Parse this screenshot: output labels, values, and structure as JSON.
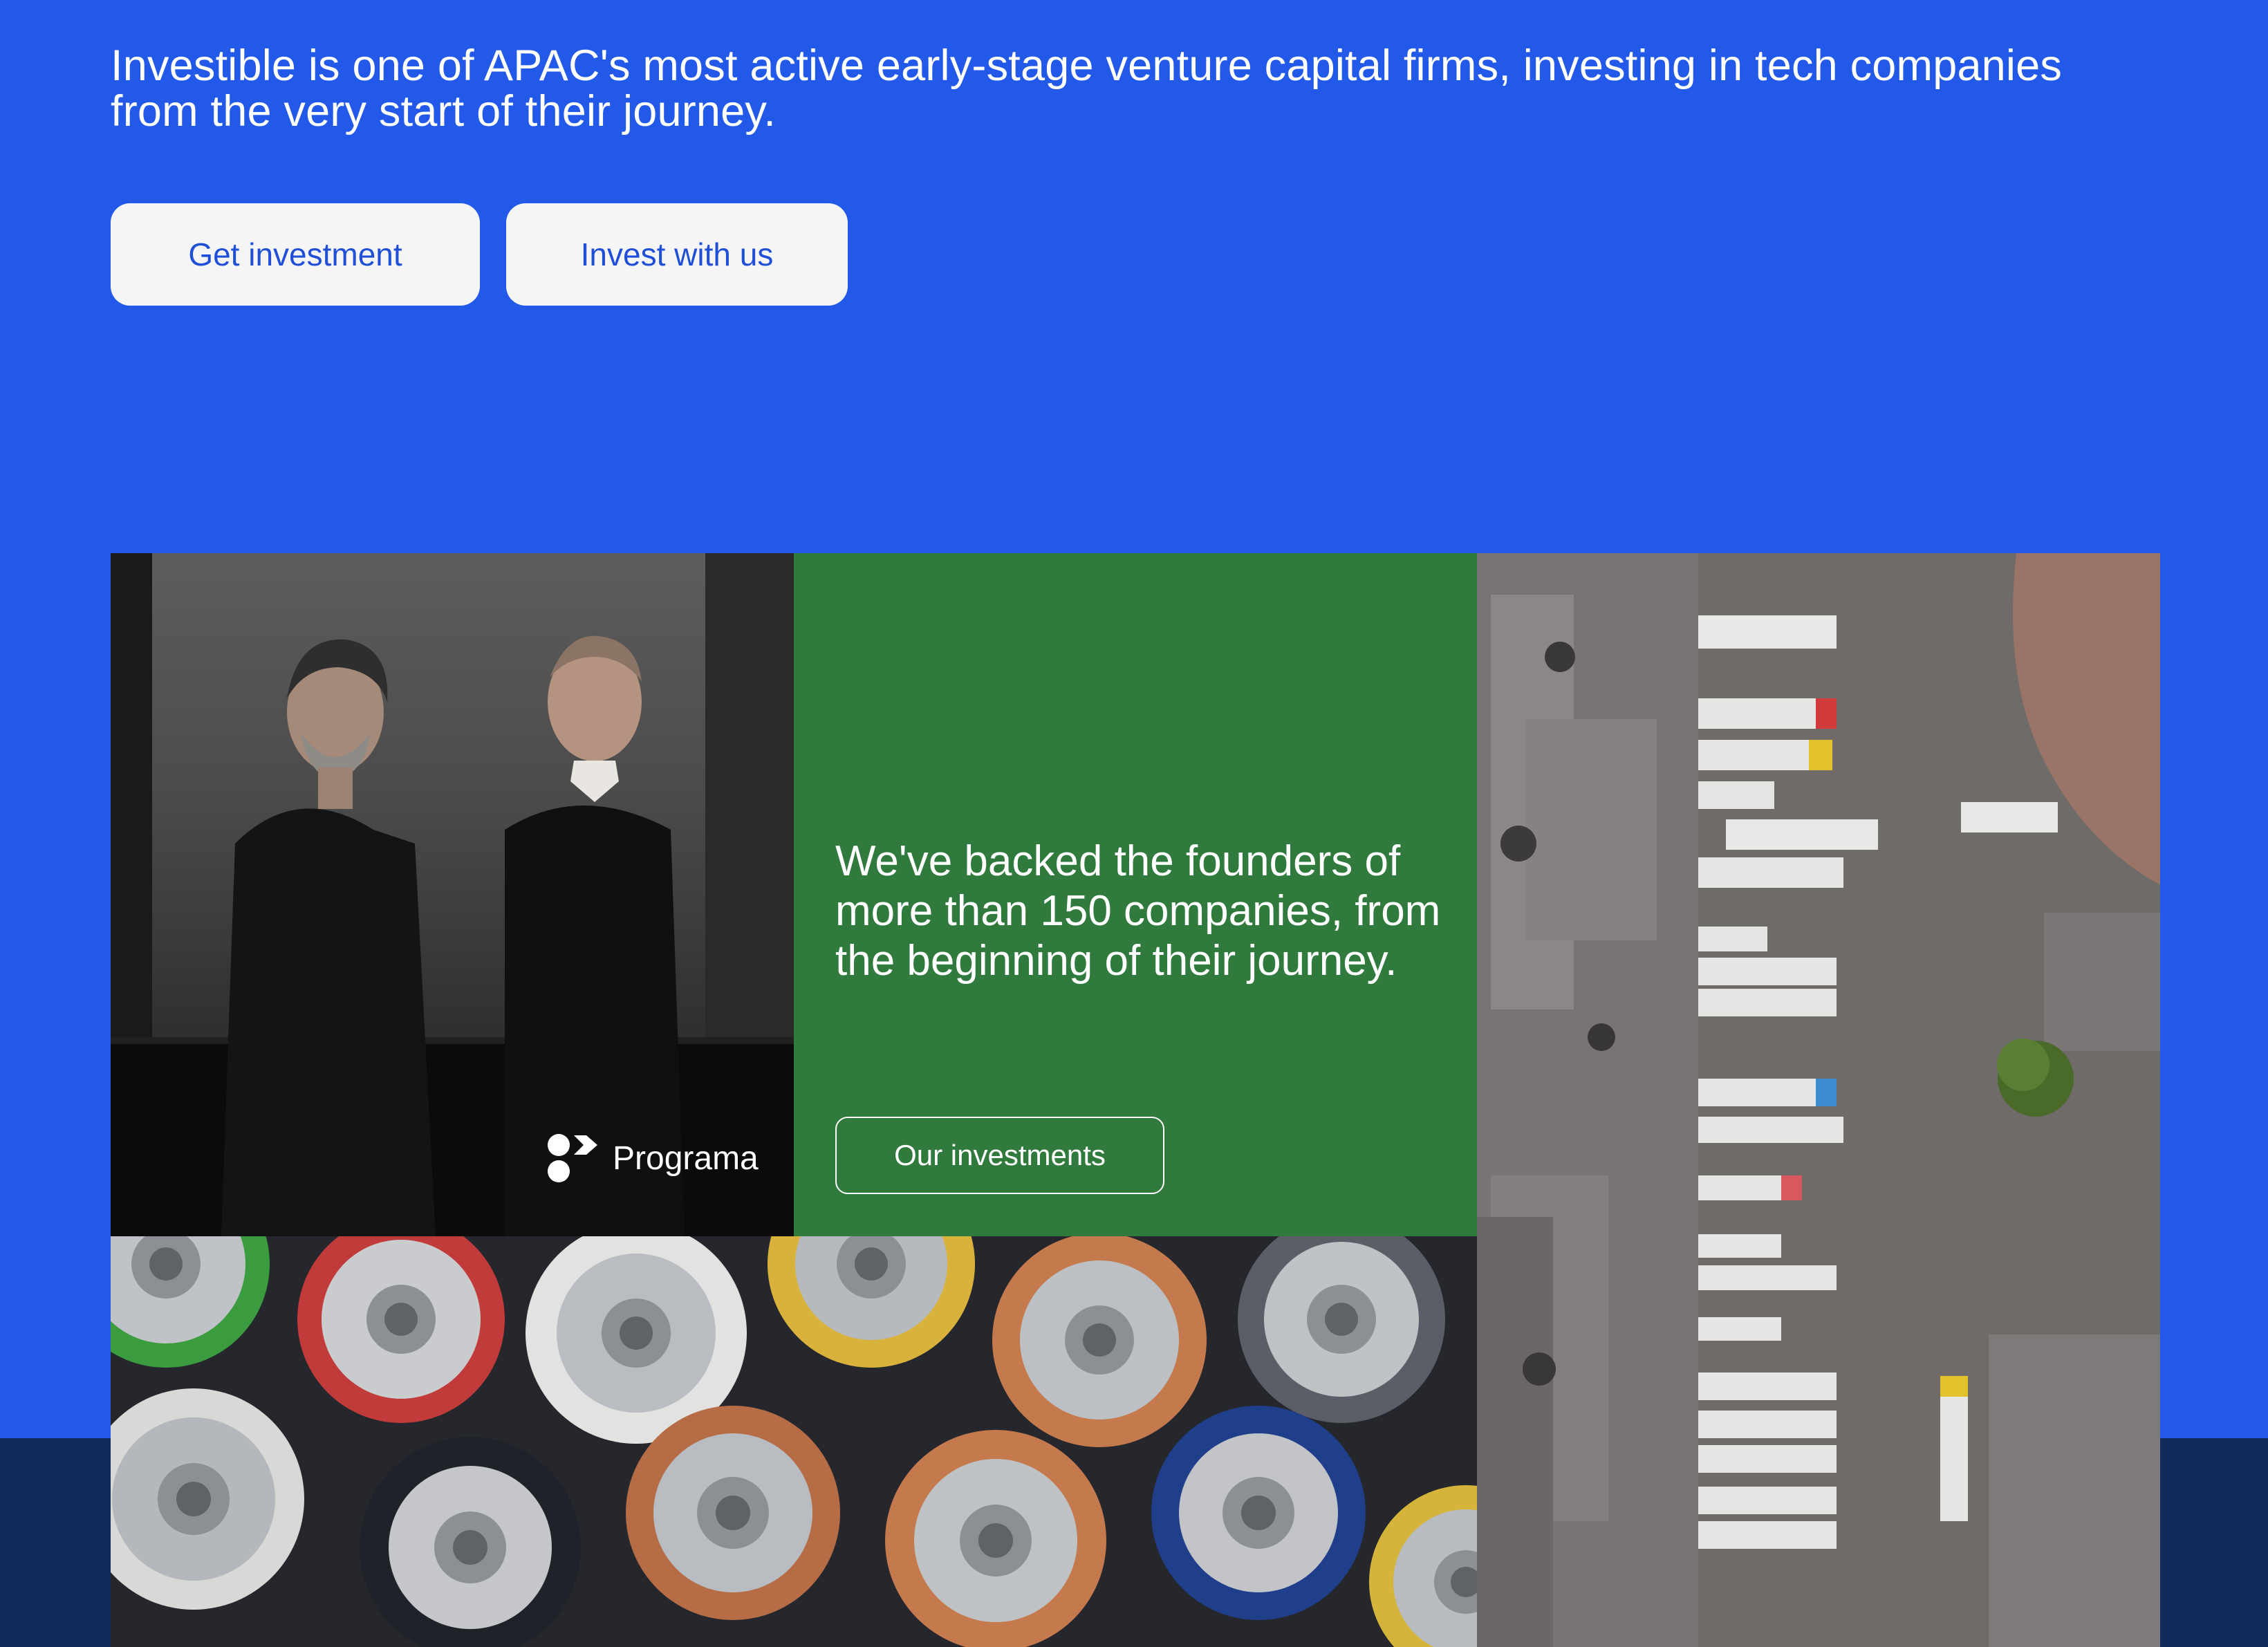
{
  "hero": {
    "intro": "Investible is one of APAC's most active early-stage venture capital firms, investing in tech companies from the very start of their journey.",
    "cta_primary": "Get investment",
    "cta_secondary": "Invest with us"
  },
  "founders": {
    "brand_label": "Programa"
  },
  "highlight": {
    "text": "We've backed the founders of more than 150 companies, from the beginning of their journey.",
    "button_label": "Our investments"
  },
  "colors": {
    "hero_background": "#2359e8",
    "footer_band": "#132a5c",
    "highlight_tile": "#317a3d",
    "button_background": "#f5f5f6",
    "button_text": "#1f4fd6"
  },
  "icons": {
    "brand_mark": "programa-logo-icon"
  }
}
